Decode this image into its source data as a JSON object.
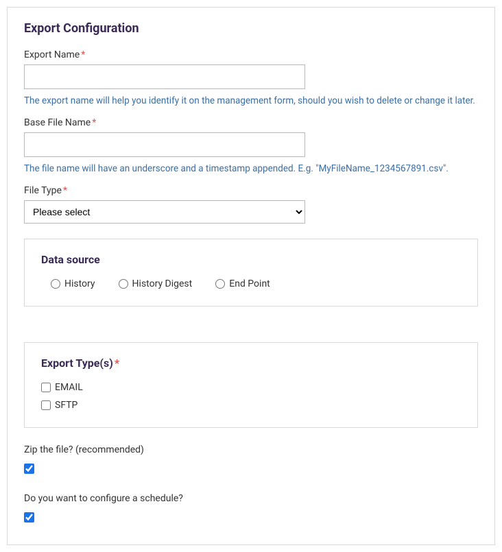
{
  "panel": {
    "title": "Export Configuration",
    "exportName": {
      "label": "Export Name",
      "value": "",
      "helper": "The export name will help you identify it on the management form, should you wish to delete or change it later."
    },
    "baseFileName": {
      "label": "Base File Name",
      "value": "",
      "helper": "The file name will have an underscore and a timestamp appended. E.g. \"MyFileName_1234567891.csv\"."
    },
    "fileType": {
      "label": "File Type",
      "selected": "Please select"
    },
    "dataSource": {
      "title": "Data source",
      "options": {
        "history": "History",
        "historyDigest": "History Digest",
        "endPoint": "End Point"
      }
    },
    "exportTypes": {
      "title": "Export Type(s)",
      "options": {
        "email": "EMAIL",
        "sftp": "SFTP"
      }
    },
    "zip": {
      "label": "Zip the file? (recommended)",
      "checked": true
    },
    "schedule": {
      "label": "Do you want to configure a schedule?",
      "checked": true
    },
    "requiredMark": "*"
  }
}
